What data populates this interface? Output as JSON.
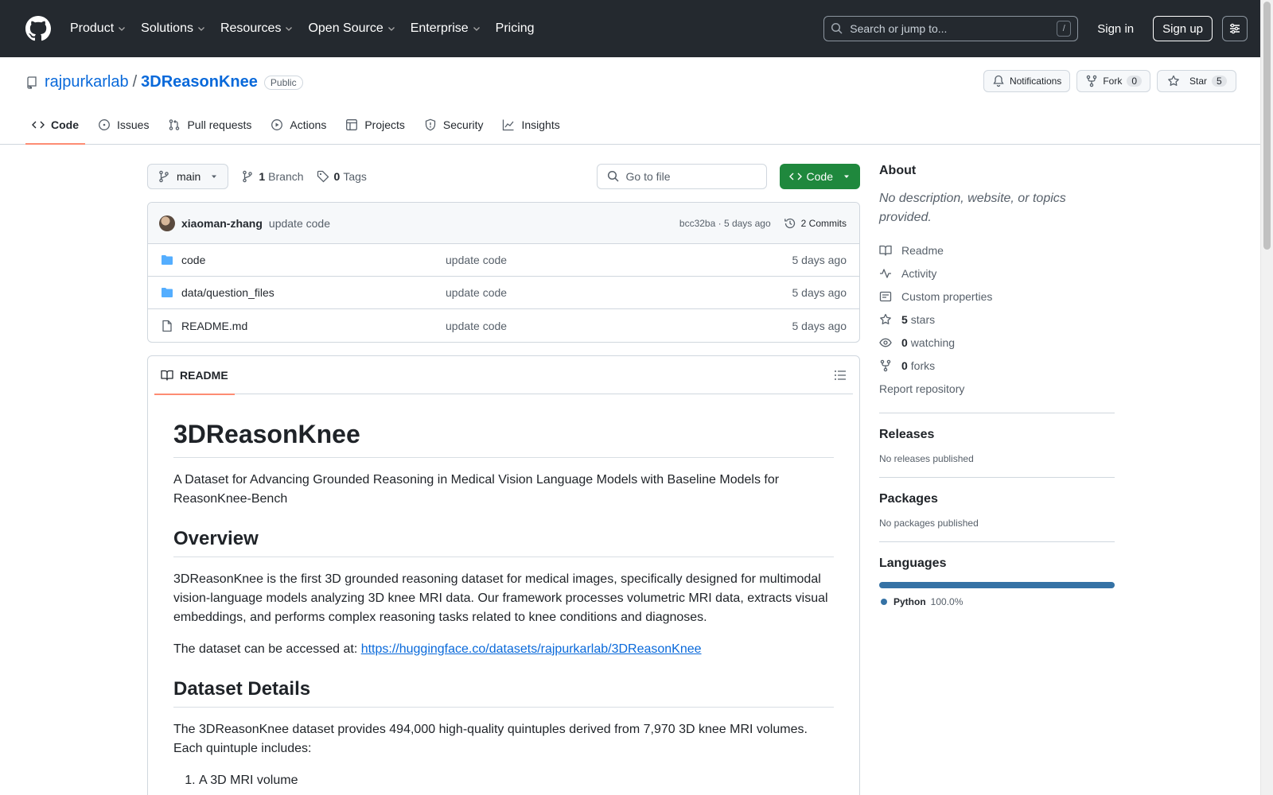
{
  "header": {
    "nav": [
      "Product",
      "Solutions",
      "Resources",
      "Open Source",
      "Enterprise",
      "Pricing"
    ],
    "search_placeholder": "Search or jump to...",
    "search_shortcut": "/",
    "signin": "Sign in",
    "signup": "Sign up"
  },
  "repo": {
    "owner": "rajpurkarlab",
    "separator": "/",
    "name": "3DReasonKnee",
    "visibility": "Public",
    "notifications_label": "Notifications",
    "fork_label": "Fork",
    "fork_count": "0",
    "star_label": "Star",
    "star_count": "5"
  },
  "tabs": [
    {
      "label": "Code",
      "icon": "code-icon"
    },
    {
      "label": "Issues",
      "icon": "issue-icon"
    },
    {
      "label": "Pull requests",
      "icon": "pull-request-icon"
    },
    {
      "label": "Actions",
      "icon": "play-icon"
    },
    {
      "label": "Projects",
      "icon": "table-icon"
    },
    {
      "label": "Security",
      "icon": "shield-icon"
    },
    {
      "label": "Insights",
      "icon": "graph-icon"
    }
  ],
  "toolbar": {
    "branch": "main",
    "branch_count": "1",
    "branch_label": "Branch",
    "tag_count": "0",
    "tag_label": "Tags",
    "goto_placeholder": "Go to file",
    "code_label": "Code"
  },
  "commit": {
    "author": "xiaoman-zhang",
    "message": "update code",
    "meta": "bcc32ba · 5 days ago",
    "commits": "2 Commits"
  },
  "files": [
    {
      "name": "code",
      "type": "folder",
      "message": "update code",
      "age": "5 days ago"
    },
    {
      "name": "data/question_files",
      "type": "folder",
      "message": "update code",
      "age": "5 days ago"
    },
    {
      "name": "README.md",
      "type": "file",
      "message": "update code",
      "age": "5 days ago"
    }
  ],
  "readme": {
    "tab_label": "README",
    "title": "3DReasonKnee",
    "subtitle": "A Dataset for Advancing Grounded Reasoning in Medical Vision Language Models with Baseline Models for ReasonKnee-Bench",
    "overview_heading": "Overview",
    "overview_text": "3DReasonKnee is the first 3D grounded reasoning dataset for medical images, specifically designed for multimodal vision-language models analyzing 3D knee MRI data. Our framework processes volumetric MRI data, extracts visual embeddings, and performs complex reasoning tasks related to knee conditions and diagnoses.",
    "access_text": "The dataset can be accessed at: ",
    "access_link": "https://huggingface.co/datasets/rajpurkarlab/3DReasonKnee",
    "details_heading": "Dataset Details",
    "details_text": "The 3DReasonKnee dataset provides 494,000 high-quality quintuples derived from 7,970 3D knee MRI volumes. Each quintuple includes:",
    "list": [
      "A 3D MRI volume"
    ]
  },
  "sidebar": {
    "about_heading": "About",
    "about_desc": "No description, website, or topics provided.",
    "readme": "Readme",
    "activity": "Activity",
    "custom_properties": "Custom properties",
    "stars_count": "5",
    "stars_label": "stars",
    "watching_count": "0",
    "watching_label": "watching",
    "forks_count": "0",
    "forks_label": "forks",
    "report": "Report repository",
    "releases_heading": "Releases",
    "releases_text": "No releases published",
    "packages_heading": "Packages",
    "packages_text": "No packages published",
    "languages_heading": "Languages",
    "language_name": "Python",
    "language_pct": "100.0%",
    "language_color": "#3572A5"
  }
}
